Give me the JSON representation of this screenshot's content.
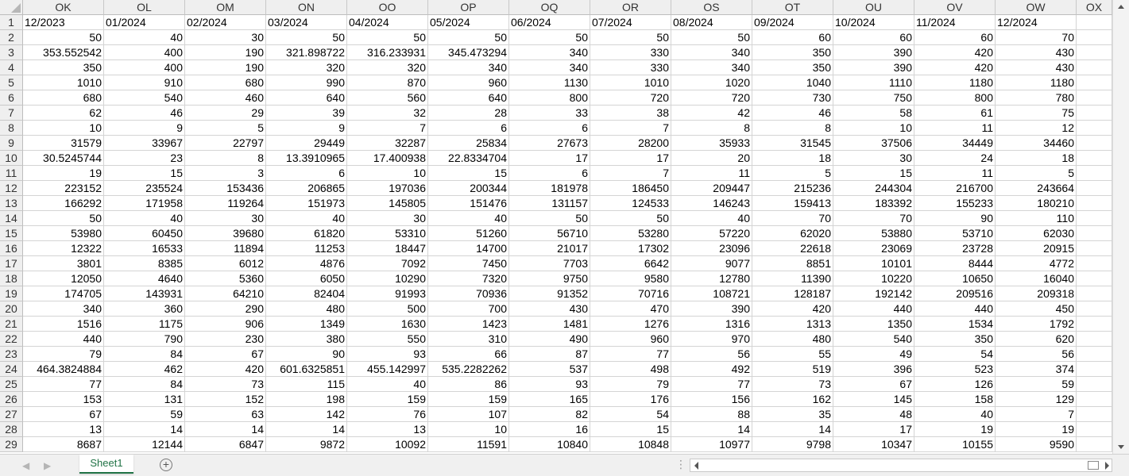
{
  "columns": [
    "OK",
    "OL",
    "OM",
    "ON",
    "OO",
    "OP",
    "OQ",
    "OR",
    "OS",
    "OT",
    "OU",
    "OV",
    "OW",
    "OX"
  ],
  "row_numbers": [
    "1",
    "2",
    "3",
    "4",
    "5",
    "6",
    "7",
    "8",
    "9",
    "10",
    "11",
    "12",
    "13",
    "14",
    "15",
    "16",
    "17",
    "18",
    "19",
    "20",
    "21",
    "22",
    "23",
    "24",
    "25",
    "26",
    "27",
    "28",
    "29"
  ],
  "header_row": [
    "12/2023",
    "01/2024",
    "02/2024",
    "03/2024",
    "04/2024",
    "05/2024",
    "06/2024",
    "07/2024",
    "08/2024",
    "09/2024",
    "10/2024",
    "11/2024",
    "12/2024"
  ],
  "rows": [
    [
      "50",
      "40",
      "30",
      "50",
      "50",
      "50",
      "50",
      "50",
      "50",
      "60",
      "60",
      "60",
      "70"
    ],
    [
      "353.552542",
      "400",
      "190",
      "321.898722",
      "316.233931",
      "345.473294",
      "340",
      "330",
      "340",
      "350",
      "390",
      "420",
      "430"
    ],
    [
      "350",
      "400",
      "190",
      "320",
      "320",
      "340",
      "340",
      "330",
      "340",
      "350",
      "390",
      "420",
      "430"
    ],
    [
      "1010",
      "910",
      "680",
      "990",
      "870",
      "960",
      "1130",
      "1010",
      "1020",
      "1040",
      "1110",
      "1180",
      "1180"
    ],
    [
      "680",
      "540",
      "460",
      "640",
      "560",
      "640",
      "800",
      "720",
      "720",
      "730",
      "750",
      "800",
      "780"
    ],
    [
      "62",
      "46",
      "29",
      "39",
      "32",
      "28",
      "33",
      "38",
      "42",
      "46",
      "58",
      "61",
      "75"
    ],
    [
      "10",
      "9",
      "5",
      "9",
      "7",
      "6",
      "6",
      "7",
      "8",
      "8",
      "10",
      "11",
      "12"
    ],
    [
      "31579",
      "33967",
      "22797",
      "29449",
      "32287",
      "25834",
      "27673",
      "28200",
      "35933",
      "31545",
      "37506",
      "34449",
      "34460"
    ],
    [
      "30.5245744",
      "23",
      "8",
      "13.3910965",
      "17.400938",
      "22.8334704",
      "17",
      "17",
      "20",
      "18",
      "30",
      "24",
      "18"
    ],
    [
      "19",
      "15",
      "3",
      "6",
      "10",
      "15",
      "6",
      "7",
      "11",
      "5",
      "15",
      "11",
      "5"
    ],
    [
      "223152",
      "235524",
      "153436",
      "206865",
      "197036",
      "200344",
      "181978",
      "186450",
      "209447",
      "215236",
      "244304",
      "216700",
      "243664"
    ],
    [
      "166292",
      "171958",
      "119264",
      "151973",
      "145805",
      "151476",
      "131157",
      "124533",
      "146243",
      "159413",
      "183392",
      "155233",
      "180210"
    ],
    [
      "50",
      "40",
      "30",
      "40",
      "30",
      "40",
      "50",
      "50",
      "40",
      "70",
      "70",
      "90",
      "110"
    ],
    [
      "53980",
      "60450",
      "39680",
      "61820",
      "53310",
      "51260",
      "56710",
      "53280",
      "57220",
      "62020",
      "53880",
      "53710",
      "62030"
    ],
    [
      "12322",
      "16533",
      "11894",
      "11253",
      "18447",
      "14700",
      "21017",
      "17302",
      "23096",
      "22618",
      "23069",
      "23728",
      "20915"
    ],
    [
      "3801",
      "8385",
      "6012",
      "4876",
      "7092",
      "7450",
      "7703",
      "6642",
      "9077",
      "8851",
      "10101",
      "8444",
      "4772"
    ],
    [
      "12050",
      "4640",
      "5360",
      "6050",
      "10290",
      "7320",
      "9750",
      "9580",
      "12780",
      "11390",
      "10220",
      "10650",
      "16040"
    ],
    [
      "174705",
      "143931",
      "64210",
      "82404",
      "91993",
      "70936",
      "91352",
      "70716",
      "108721",
      "128187",
      "192142",
      "209516",
      "209318"
    ],
    [
      "340",
      "360",
      "290",
      "480",
      "500",
      "700",
      "430",
      "470",
      "390",
      "420",
      "440",
      "440",
      "450"
    ],
    [
      "1516",
      "1175",
      "906",
      "1349",
      "1630",
      "1423",
      "1481",
      "1276",
      "1316",
      "1313",
      "1350",
      "1534",
      "1792"
    ],
    [
      "440",
      "790",
      "230",
      "380",
      "550",
      "310",
      "490",
      "960",
      "970",
      "480",
      "540",
      "350",
      "620"
    ],
    [
      "79",
      "84",
      "67",
      "90",
      "93",
      "66",
      "87",
      "77",
      "56",
      "55",
      "49",
      "54",
      "56"
    ],
    [
      "464.3824884",
      "462",
      "420",
      "601.6325851",
      "455.142997",
      "535.2282262",
      "537",
      "498",
      "492",
      "519",
      "396",
      "523",
      "374"
    ],
    [
      "77",
      "84",
      "73",
      "115",
      "40",
      "86",
      "93",
      "79",
      "77",
      "73",
      "67",
      "126",
      "59"
    ],
    [
      "153",
      "131",
      "152",
      "198",
      "159",
      "159",
      "165",
      "176",
      "156",
      "162",
      "145",
      "158",
      "129"
    ],
    [
      "67",
      "59",
      "63",
      "142",
      "76",
      "107",
      "82",
      "54",
      "88",
      "35",
      "48",
      "40",
      "7"
    ],
    [
      "13",
      "14",
      "14",
      "14",
      "13",
      "10",
      "16",
      "15",
      "14",
      "14",
      "17",
      "19",
      "19"
    ],
    [
      "8687",
      "12144",
      "6847",
      "9872",
      "10092",
      "11591",
      "10840",
      "10848",
      "10977",
      "9798",
      "10347",
      "10155",
      "9590"
    ]
  ],
  "sheet_tab": "Sheet1",
  "add_sheet_symbol": "+",
  "dots_symbol": "⋮",
  "nav_prev": "◀",
  "nav_next": "▶"
}
